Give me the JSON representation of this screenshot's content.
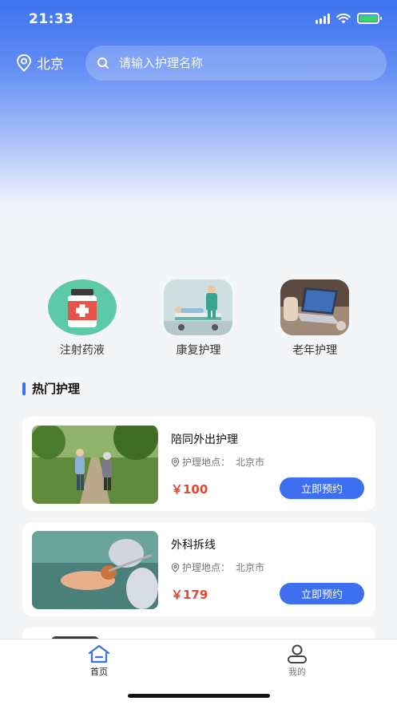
{
  "status_bar": {
    "time": "21:33"
  },
  "header": {
    "location": "北京",
    "search_placeholder": "请输入护理名称"
  },
  "categories": [
    {
      "label": "注射药液",
      "icon": "medicine-bottle-icon"
    },
    {
      "label": "康复护理",
      "icon": "rehab-nurse-icon"
    },
    {
      "label": "老年护理",
      "icon": "laptop-care-icon"
    }
  ],
  "section": {
    "title": "热门护理"
  },
  "services": [
    {
      "title": "陪同外出护理",
      "address_label": "护理地点：",
      "address": "北京市",
      "price": "￥100",
      "button": "立即预约"
    },
    {
      "title": "外科拆线",
      "address_label": "护理地点：",
      "address": "北京市",
      "price": "￥179",
      "button": "立即预约"
    }
  ],
  "tabbar": [
    {
      "label": "首页",
      "active": true
    },
    {
      "label": "我的",
      "active": false
    }
  ],
  "colors": {
    "primary": "#3d6ff0",
    "price": "#e8462e",
    "active_tab": "#3b6ef0",
    "inactive_tab": "#777777"
  }
}
